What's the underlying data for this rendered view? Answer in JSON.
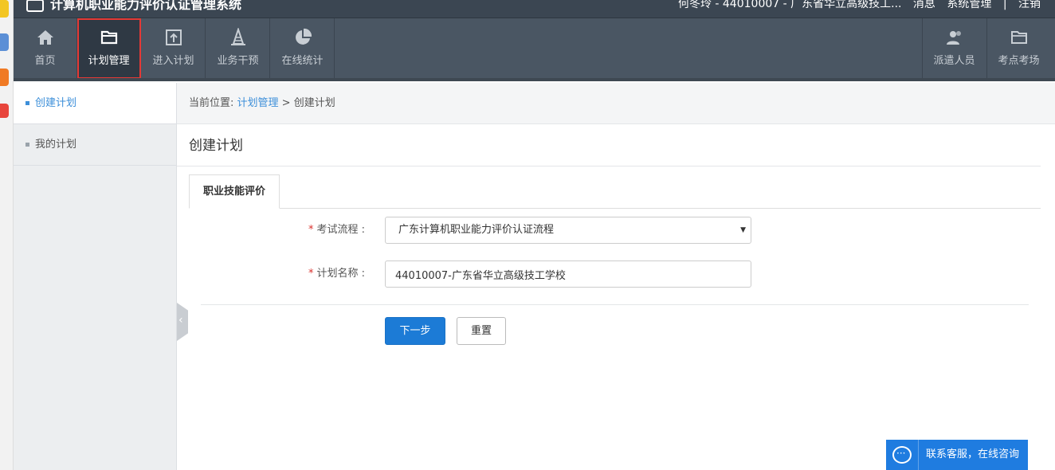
{
  "app": {
    "title": "计算机职业能力评价认证管理系统",
    "user_info": "何冬玲 - 44010007 - 广东省华立高级技工...",
    "header_links": [
      "消息",
      "系统管理",
      "|",
      "注销"
    ]
  },
  "nav": {
    "items": [
      {
        "label": "首页",
        "icon": "home-icon"
      },
      {
        "label": "计划管理",
        "icon": "folder-icon"
      },
      {
        "label": "进入计划",
        "icon": "enter-icon"
      },
      {
        "label": "业务干预",
        "icon": "cone-icon"
      },
      {
        "label": "在线统计",
        "icon": "pie-chart-icon"
      }
    ],
    "right_items": [
      {
        "label": "派遣人员",
        "icon": "users-icon"
      },
      {
        "label": "考点考场",
        "icon": "folder-icon"
      }
    ]
  },
  "sidebar": {
    "items": [
      {
        "label": "创建计划"
      },
      {
        "label": "我的计划"
      }
    ]
  },
  "breadcrumb": {
    "prefix": "当前位置: ",
    "parent": "计划管理",
    "separator": " > ",
    "current": "创建计划"
  },
  "page": {
    "title": "创建计划",
    "tab": "职业技能评价"
  },
  "form": {
    "required_mark": "*",
    "process_label": "考试流程 :",
    "process_value": "广东计算机职业能力评价认证流程",
    "name_label": "计划名称 :",
    "name_value": "44010007-广东省华立高级技工学校"
  },
  "buttons": {
    "next": "下一步",
    "reset": "重置"
  },
  "chat": {
    "label": "联系客服，在线咨询"
  },
  "colors": {
    "nav_bg": "#4a5663",
    "primary": "#1c7bd6",
    "link": "#3d8fd9",
    "highlight_border": "#e53935"
  }
}
